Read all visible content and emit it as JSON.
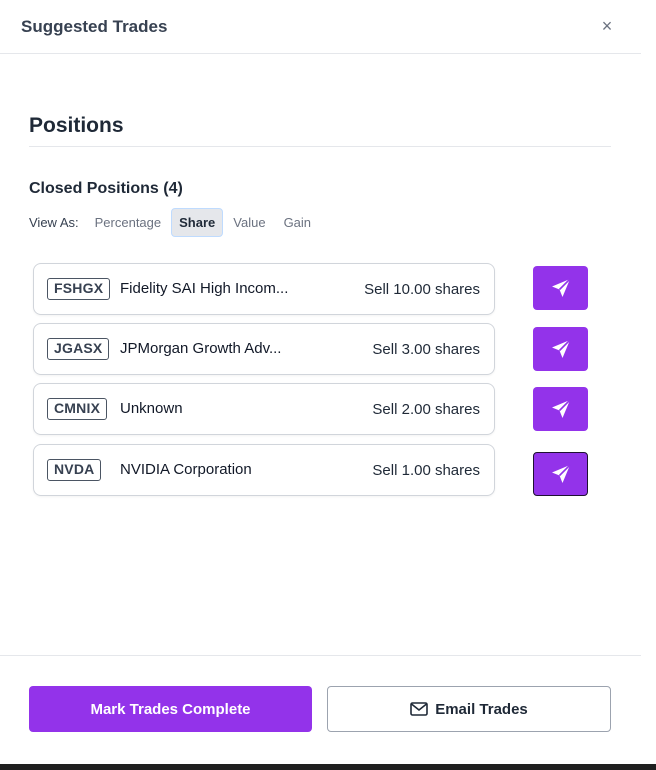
{
  "header": {
    "title": "Suggested Trades",
    "close_icon": "×"
  },
  "positions": {
    "title": "Positions"
  },
  "closed": {
    "title": "Closed Positions (4)"
  },
  "view_as": {
    "label": "View As:",
    "options": [
      "Percentage",
      "Share",
      "Value",
      "Gain"
    ],
    "selected": "Share"
  },
  "trades": [
    {
      "ticker": "FSHGX",
      "name": "Fidelity SAI High Incom...",
      "action": "Sell 10.00 shares"
    },
    {
      "ticker": "JGASX",
      "name": "JPMorgan Growth Adv...",
      "action": "Sell 3.00 shares"
    },
    {
      "ticker": "CMNIX",
      "name": "Unknown",
      "action": "Sell 2.00 shares"
    },
    {
      "ticker": "NVDA",
      "name": "NVIDIA Corporation",
      "action": "Sell 1.00 shares"
    }
  ],
  "footer": {
    "primary_label": "Mark Trades Complete",
    "secondary_label": "Email Trades"
  },
  "colors": {
    "accent": "#9333ea",
    "border": "#d1d5db"
  },
  "icons": {
    "send": "send-icon",
    "email": "mail-icon",
    "close": "close-icon"
  }
}
